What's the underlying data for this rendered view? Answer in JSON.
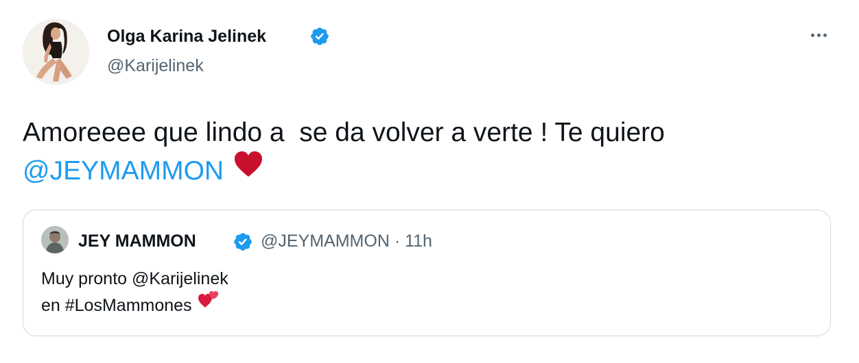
{
  "author": {
    "display_name": "Olga Karina Jelinek",
    "handle": "@Karijelinek",
    "verified": true
  },
  "tweet": {
    "text": "Amoreeee que lindo a  se da volver a verte ! Te quiero",
    "mention": "@JEYMAMMON",
    "emoji": "heart"
  },
  "quoted_tweet": {
    "display_name": "JEY MAMMON",
    "handle_and_time": "@JEYMAMMON · 11h",
    "verified": true,
    "line1_text": "Muy pronto ",
    "line1_mention": "@Karijelinek",
    "line2_text": "en #LosMammones",
    "emoji": "two-hearts"
  },
  "colors": {
    "link": "#1d9bf0",
    "verified_badge": "#1d9bf0",
    "secondary_text": "#536471",
    "heart": "#c8102e",
    "border": "#cfd9de"
  }
}
